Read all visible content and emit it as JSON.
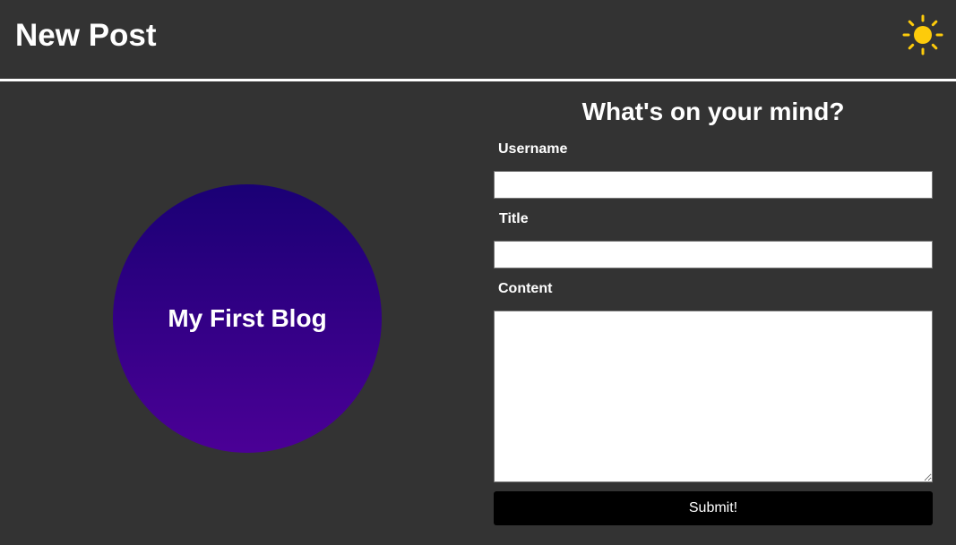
{
  "header": {
    "title": "New Post",
    "theme_icon": "sun-icon",
    "theme_icon_color": "#FDCB0B"
  },
  "hero": {
    "label": "My First Blog",
    "gradient_start": "#1A0075",
    "gradient_end": "#4B0096"
  },
  "form": {
    "heading": "What's on your mind?",
    "username_label": "Username",
    "username_value": "",
    "title_label": "Title",
    "title_value": "",
    "content_label": "Content",
    "content_value": "",
    "submit_label": "Submit!"
  },
  "colors": {
    "background": "#333333",
    "text": "#FFFFFF",
    "button": "#000000"
  }
}
